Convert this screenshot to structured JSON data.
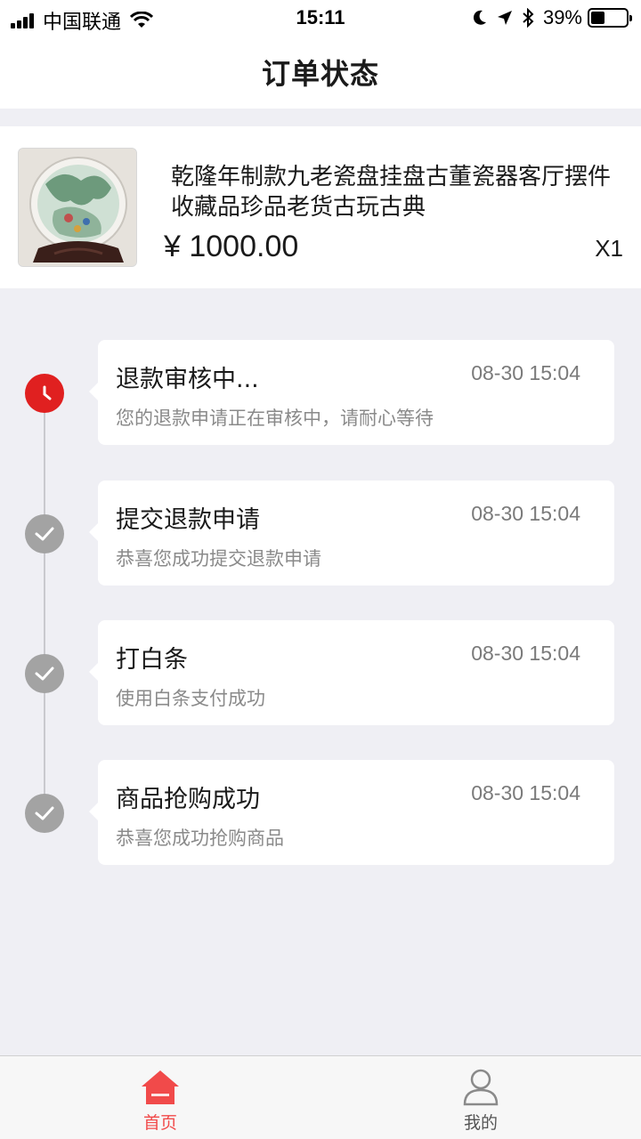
{
  "status_bar": {
    "carrier": "中国联通",
    "time": "15:11",
    "battery": "39%",
    "battery_level": 0.39
  },
  "nav": {
    "title": "订单状态"
  },
  "product": {
    "title": "乾隆年制款九老瓷盘挂盘古董瓷器客厅摆件收藏品珍品老货古玩古典",
    "price": "¥ 1000.00",
    "quantity": "X1",
    "image_icon": "porcelain-plate-image"
  },
  "timeline": [
    {
      "title": "退款审核中...",
      "time": "08-30 15:04",
      "desc": "您的退款申请正在审核中，请耐心等待",
      "status": "active",
      "icon": "clock-icon"
    },
    {
      "title": "提交退款申请",
      "time": "08-30 15:04",
      "desc": "恭喜您成功提交退款申请",
      "status": "done",
      "icon": "check-icon"
    },
    {
      "title": "打白条",
      "time": "08-30 15:04",
      "desc": "使用白条支付成功",
      "status": "done",
      "icon": "check-icon"
    },
    {
      "title": "商品抢购成功",
      "time": "08-30 15:04",
      "desc": "恭喜您成功抢购商品",
      "status": "done",
      "icon": "check-icon"
    }
  ],
  "tabs": [
    {
      "label": "首页",
      "icon": "home-icon",
      "active": true
    },
    {
      "label": "我的",
      "icon": "user-icon",
      "active": false
    }
  ],
  "colors": {
    "accent_red": "#e02020",
    "tab_active": "#f14a4a",
    "done_gray": "#a3a3a3",
    "page_bg": "#efeff4"
  }
}
